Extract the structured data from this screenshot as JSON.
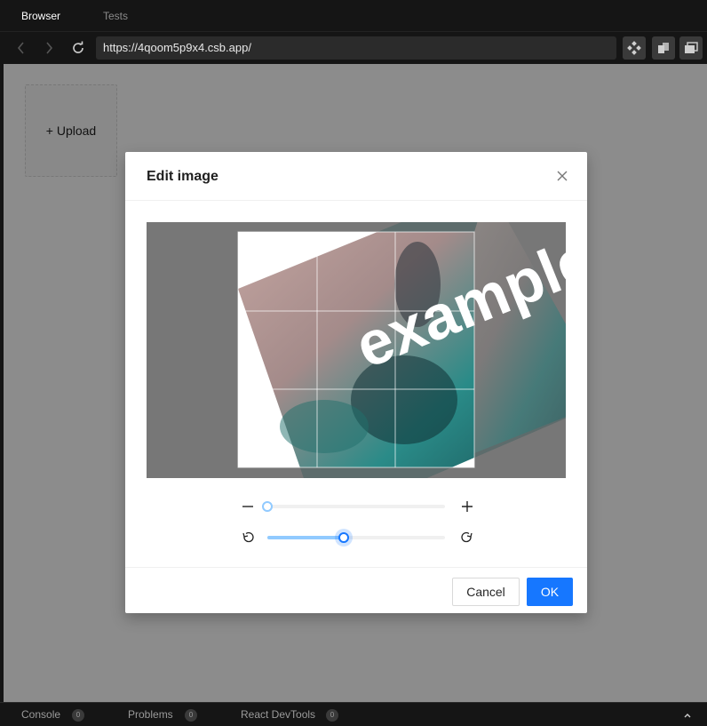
{
  "tabs": [
    {
      "label": "Browser",
      "active": true
    },
    {
      "label": "Tests",
      "active": false
    }
  ],
  "address_bar": {
    "url": "https://4qoom5p9x4.csb.app/"
  },
  "toolbar_icons": [
    "back-icon",
    "forward-icon",
    "refresh-icon",
    "devtools-icon",
    "copy-icon",
    "windows-icon"
  ],
  "page": {
    "upload_label": "+ Upload"
  },
  "modal": {
    "title": "Edit image",
    "zoom": {
      "decrease_icon": "minus-icon",
      "increase_icon": "plus-icon",
      "value_fraction": 0.0
    },
    "rotate": {
      "left_icon": "rotate-left-icon",
      "right_icon": "rotate-right-icon",
      "value_fraction": 0.43
    },
    "image_watermark_text": "example",
    "cancel_label": "Cancel",
    "ok_label": "OK"
  },
  "bottom_bar": {
    "items": [
      {
        "label": "Console",
        "count": "0"
      },
      {
        "label": "Problems",
        "count": "0"
      },
      {
        "label": "React DevTools",
        "count": "0"
      }
    ]
  },
  "colors": {
    "primary": "#1677ff",
    "slider_track": "#91caff",
    "chrome_bg": "#151515"
  }
}
